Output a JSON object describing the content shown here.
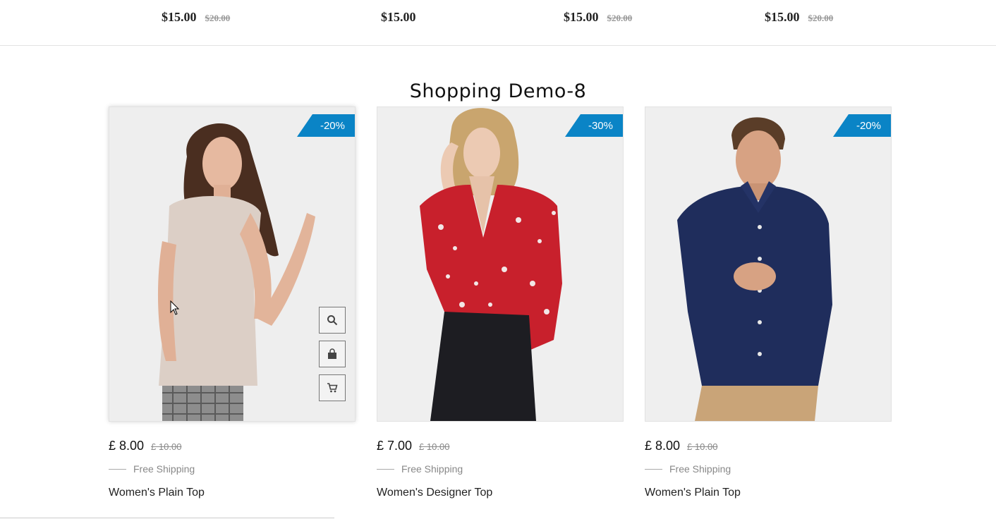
{
  "top_row": [
    {
      "price": "$15.00",
      "old_price": "$20.00"
    },
    {
      "price": "$15.00",
      "old_price": ""
    },
    {
      "price": "$15.00",
      "old_price": "$20.00"
    },
    {
      "price": "$15.00",
      "old_price": "$20.00"
    }
  ],
  "section": {
    "title": "Shopping Demo-8"
  },
  "products": [
    {
      "badge": "-20%",
      "price": "£ 8.00",
      "old_price": "£ 10.00",
      "shipping": "Free Shipping",
      "name": "Women's Plain Top"
    },
    {
      "badge": "-30%",
      "price": "£ 7.00",
      "old_price": "£ 10.00",
      "shipping": "Free Shipping",
      "name": "Women's Designer Top"
    },
    {
      "badge": "-20%",
      "price": "£ 8.00",
      "old_price": "£ 10.00",
      "shipping": "Free Shipping",
      "name": "Women's Plain Top"
    }
  ],
  "hover_actions": [
    {
      "icon": "search-icon"
    },
    {
      "icon": "shopping-bag-icon"
    },
    {
      "icon": "cart-icon"
    }
  ],
  "colors": {
    "badge": "#0a84c6",
    "background": "#ffffff",
    "image_bg": "#efefef"
  }
}
